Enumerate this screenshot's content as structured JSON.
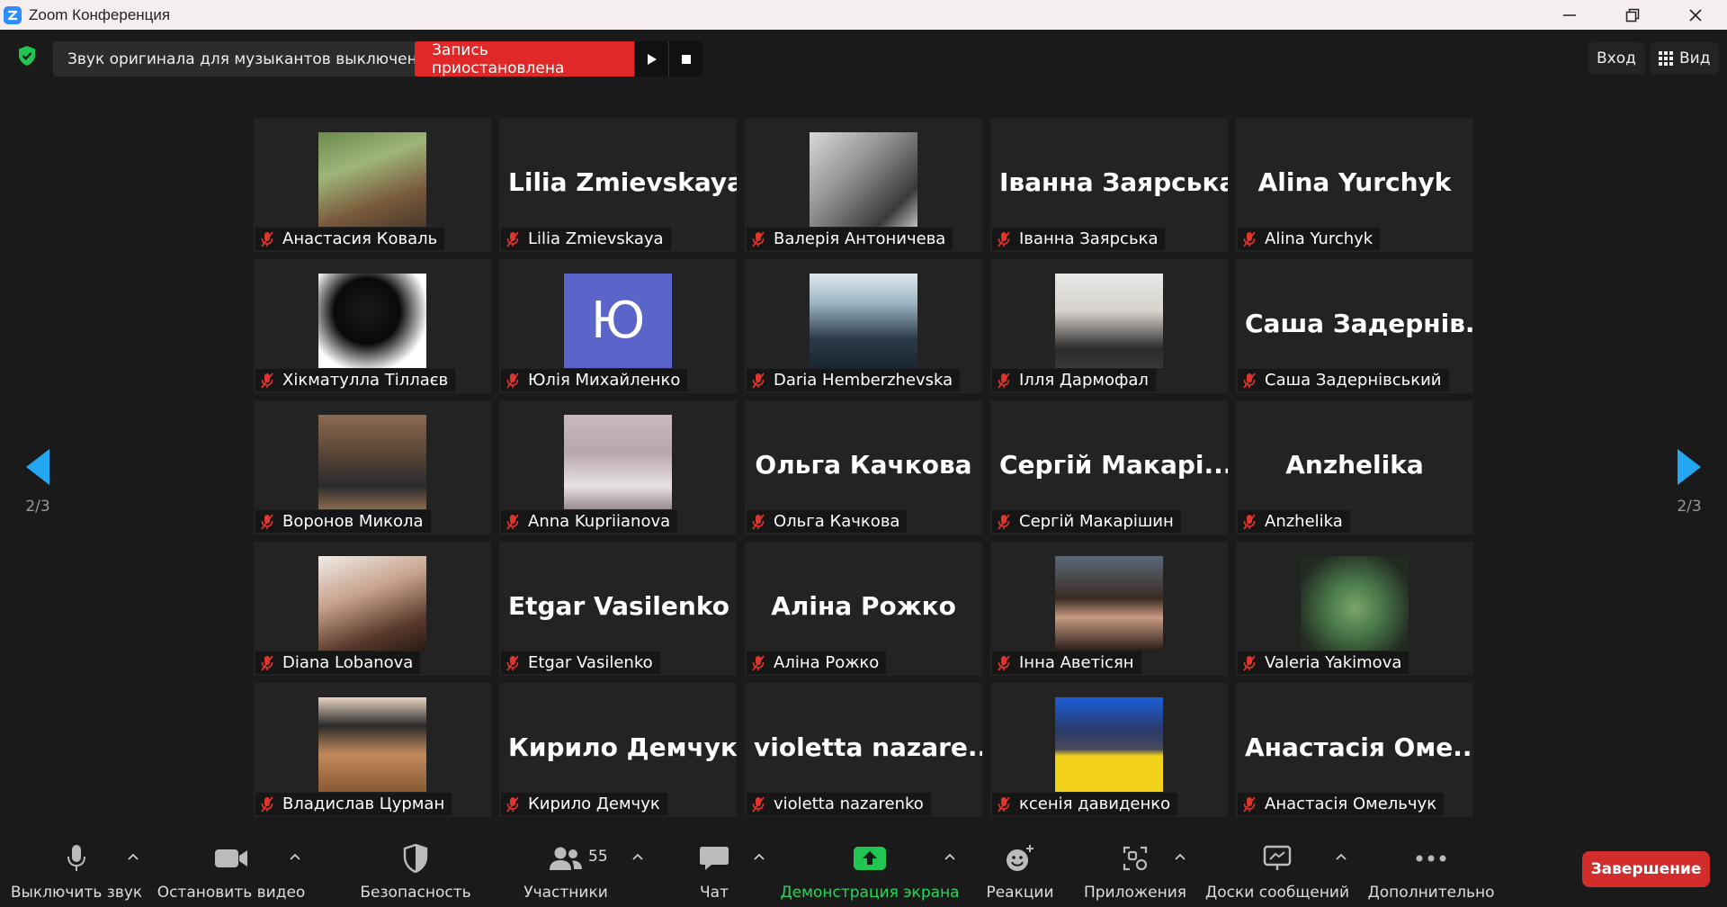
{
  "window": {
    "title": "Zoom Конференция"
  },
  "topbar": {
    "audio_status": "Звук оригинала для музыкантов выключен",
    "recording_status": "Запись приостановлена",
    "signin_label": "Вход",
    "view_label": "Вид"
  },
  "pagination": {
    "left": "2/3",
    "right": "2/3"
  },
  "colors": {
    "accent": "#2d8cff",
    "record": "#e02828",
    "end": "#d22d2d",
    "green": "#23d959",
    "mic_muted": "#e0352b"
  },
  "participants": [
    {
      "display_name": "Анастасия Коваль",
      "big_name": "",
      "photo": "photo-outdoor-sitting"
    },
    {
      "display_name": "Lilia Zmievskaya",
      "big_name": "Lilia Zmievskaya",
      "photo": ""
    },
    {
      "display_name": "Валерія Антоничева",
      "big_name": "",
      "photo": "photo-bw-portrait"
    },
    {
      "display_name": "Іванна Заярська",
      "big_name": "Іванна Заярська",
      "photo": ""
    },
    {
      "display_name": "Alina Yurchyk",
      "big_name": "Alina Yurchyk",
      "photo": ""
    },
    {
      "display_name": "Хікматулла Тіллаєв",
      "big_name": "",
      "photo": "photo-helmet-neon"
    },
    {
      "display_name": "Юлія  Михайленко",
      "big_name": "",
      "photo": "avatar-letter",
      "avatar_letter": "Ю"
    },
    {
      "display_name": "Daria Hemberzhevska",
      "big_name": "",
      "photo": "photo-diver"
    },
    {
      "display_name": "Ілля Дармофал",
      "big_name": "",
      "photo": "photo-portrait-light"
    },
    {
      "display_name": "Саша Задернівський",
      "big_name": "Саша  Задернів...",
      "photo": ""
    },
    {
      "display_name": "Воронов Микола",
      "big_name": "",
      "photo": "photo-hoodie-field"
    },
    {
      "display_name": "Anna Kupriianova",
      "big_name": "",
      "photo": "photo-sea"
    },
    {
      "display_name": "Ольга Качкова",
      "big_name": "Ольга Качкова",
      "photo": ""
    },
    {
      "display_name": "Сергій Макарішин",
      "big_name": "Сергій  Макарі...",
      "photo": ""
    },
    {
      "display_name": "Anzhelika",
      "big_name": "Anzhelika",
      "photo": ""
    },
    {
      "display_name": "Diana Lobanova",
      "big_name": "",
      "photo": "photo-selfie"
    },
    {
      "display_name": "Etgar Vasilenko",
      "big_name": "Etgar Vasilenko",
      "photo": ""
    },
    {
      "display_name": "Аліна Рожко",
      "big_name": "Аліна Рожко",
      "photo": ""
    },
    {
      "display_name": "Інна Аветісян",
      "big_name": "",
      "photo": "photo-selfie-night"
    },
    {
      "display_name": "Valeria Yakimova",
      "big_name": "",
      "photo": "photo-illustration-green"
    },
    {
      "display_name": "Владислав Цурман",
      "big_name": "",
      "photo": "photo-dog-cap"
    },
    {
      "display_name": "Кирило Демчук",
      "big_name": "Кирило Демчук",
      "photo": ""
    },
    {
      "display_name": "violetta nazarenko",
      "big_name": "violetta  nazare...",
      "photo": ""
    },
    {
      "display_name": "ксенія давиденко",
      "big_name": "",
      "photo": "photo-ukraine-flag"
    },
    {
      "display_name": "Анастасія Омельчук",
      "big_name": "Анастасія  Оме...",
      "photo": ""
    }
  ],
  "toolbar": {
    "mute_label": "Выключить звук",
    "video_label": "Остановить видео",
    "security_label": "Безопасность",
    "participants_label": "Участники",
    "participants_count": "55",
    "chat_label": "Чат",
    "share_label": "Демонстрация экрана",
    "reactions_label": "Реакции",
    "apps_label": "Приложения",
    "whiteboards_label": "Доски сообщений",
    "more_label": "Дополнительно",
    "end_label": "Завершение"
  }
}
